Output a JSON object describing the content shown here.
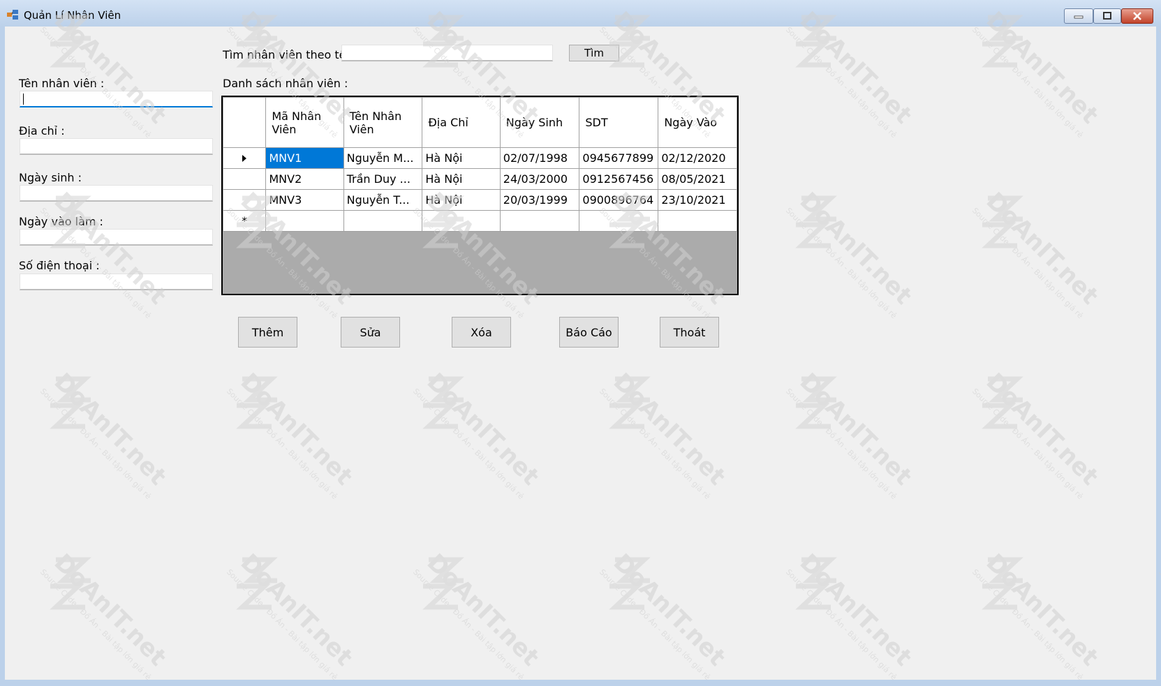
{
  "window": {
    "title": "Quản Lí Nhân Viên"
  },
  "search": {
    "label": "Tìm nhân viên theo tên :",
    "value": "",
    "button": "Tìm"
  },
  "form": {
    "name_label": "Tên nhân viên :",
    "address_label": "Địa chỉ :",
    "dob_label": "Ngày sinh :",
    "start_label": "Ngày vào làm :",
    "phone_label": "Số điện thoại :"
  },
  "list_label": "Danh sách nhân viên :",
  "table": {
    "columns": [
      "Mã Nhân Viên",
      "Tên Nhân Viên",
      "Địa Chỉ",
      "Ngày Sinh",
      "SDT",
      "Ngày Vào"
    ],
    "rows": [
      [
        "MNV1",
        "Nguyễn M...",
        "Hà Nội",
        "02/07/1998",
        "0945677899",
        "02/12/2020"
      ],
      [
        "MNV2",
        "Trần Duy ...",
        "Hà Nội",
        "24/03/2000",
        "0912567456",
        "08/05/2021"
      ],
      [
        "MNV3",
        "Nguyễn T...",
        "Hà Nội",
        "20/03/1999",
        "0900896764",
        "23/10/2021"
      ]
    ],
    "new_row_marker": "*"
  },
  "buttons": {
    "add": "Thêm",
    "edit": "Sửa",
    "delete": "Xóa",
    "report": "Báo Cáo",
    "exit": "Thoát"
  },
  "watermark": {
    "brand": "DoAnIT.net",
    "tagline": "Source Code - Đồ Án - Bài tập lớn giá rẻ"
  },
  "colors": {
    "accent": "#0078d7",
    "client_bg": "#f0f0f0",
    "grid_empty": "#ababab"
  }
}
